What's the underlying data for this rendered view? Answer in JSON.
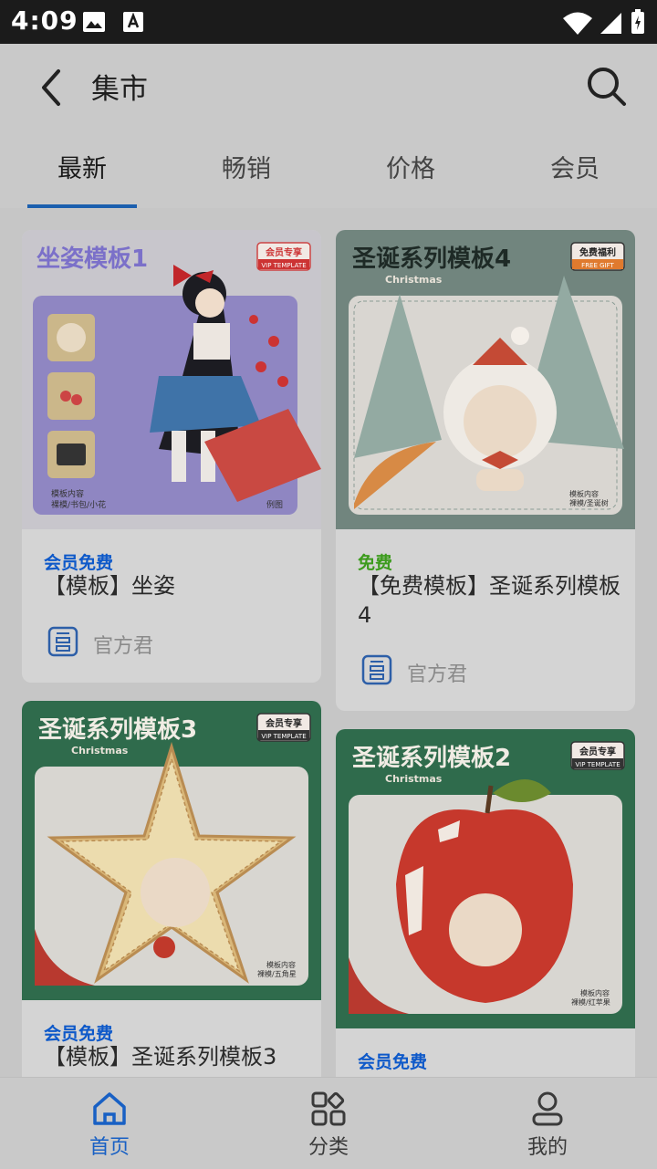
{
  "status_bar": {
    "time": "4:09"
  },
  "header": {
    "title": "集市"
  },
  "tabs": [
    {
      "label": "最新"
    },
    {
      "label": "畅销"
    },
    {
      "label": "价格"
    },
    {
      "label": "会员"
    }
  ],
  "active_tab": "最新",
  "cards": [
    {
      "thumb_title": "坐姿模板1",
      "thumb_tag": "会员专享",
      "thumb_tag_sub": "VIP TEMPLATE",
      "thumb_note_1": "模板内容",
      "thumb_note_2": "裸模/书包/小花",
      "thumb_note_3": "例图",
      "badge": "会员免费",
      "title": "【模板】坐姿",
      "author": "官方君"
    },
    {
      "thumb_title": "圣诞系列模板4",
      "thumb_sub": "Christmas",
      "thumb_tag": "免费福利",
      "thumb_tag_sub": "FREE GIFT",
      "thumb_note_1": "模板内容",
      "thumb_note_2": "裸模/圣诞树",
      "badge": "免费",
      "title": "【免费模板】圣诞系列模板4",
      "author": "官方君"
    },
    {
      "thumb_title": "圣诞系列模板3",
      "thumb_sub": "Christmas",
      "thumb_tag": "会员专享",
      "thumb_tag_sub": "VIP TEMPLATE",
      "thumb_note_1": "模板内容",
      "thumb_note_2": "裸模/五角星",
      "badge": "会员免费",
      "title": "【模板】圣诞系列模板3"
    },
    {
      "thumb_title": "圣诞系列模板2",
      "thumb_sub": "Christmas",
      "thumb_tag": "会员专享",
      "thumb_tag_sub": "VIP TEMPLATE",
      "thumb_note_1": "模板内容",
      "thumb_note_2": "裸模/红苹果",
      "badge": "会员免费"
    }
  ],
  "bottom_nav": [
    {
      "label": "首页",
      "icon": "home-icon"
    },
    {
      "label": "分类",
      "icon": "grid-icon"
    },
    {
      "label": "我的",
      "icon": "user-icon"
    }
  ],
  "colors": {
    "accent": "#1860c4",
    "free": "#3c9b1d",
    "vip": "#0e59c9"
  }
}
